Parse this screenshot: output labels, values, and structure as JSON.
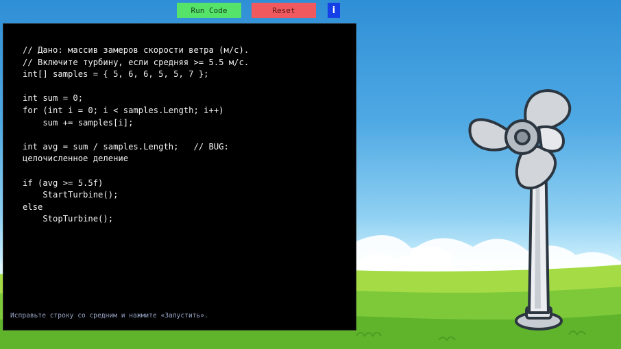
{
  "toolbar": {
    "run_label": "Run Code",
    "reset_label": "Reset",
    "info_label": "i"
  },
  "editor": {
    "lines": [
      "// Дано: массив замеров скорости ветра (м/с).",
      "// Включите турбину, если средняя >= 5.5 м/с.",
      "int[] samples = { 5, 6, 6, 5, 5, 7 };",
      "",
      "int sum = 0;",
      "for (int i = 0; i < samples.Length; i++)",
      "    sum += samples[i];",
      "",
      "int avg = sum / samples.Length;   // BUG:",
      "целочисленное деление",
      "",
      "if (avg >= 5.5f)",
      "    StartTurbine();",
      "else",
      "    StopTurbine();"
    ],
    "hint": "Исправьте строку со средним и нажмите «Запустить»."
  },
  "colors": {
    "run_button": "#55e36a",
    "reset_button": "#f05a5e",
    "info_button": "#1540e8",
    "editor_bg": "#000000"
  },
  "icons": {
    "info": "info-icon",
    "turbine": "wind-turbine-icon"
  }
}
